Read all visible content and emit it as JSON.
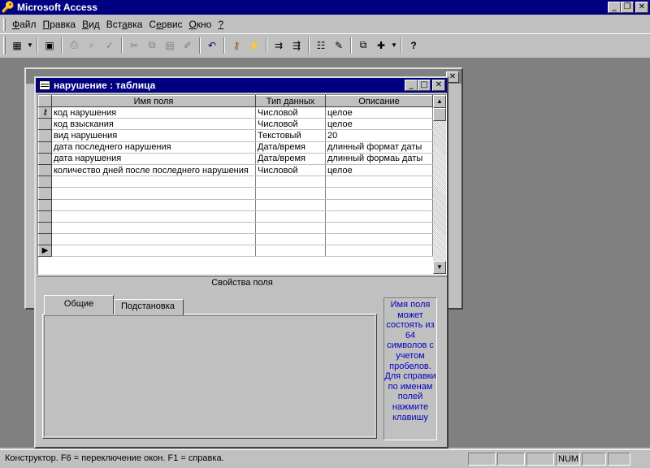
{
  "app": {
    "title": "Microsoft Access"
  },
  "menu": {
    "items": [
      {
        "u": "Ф",
        "rest": "айл"
      },
      {
        "u": "П",
        "rest": "равка"
      },
      {
        "u": "В",
        "rest": "ид"
      },
      {
        "pre": "Вст",
        "u": "а",
        "rest": "вка"
      },
      {
        "pre": "С",
        "u": "е",
        "rest": "рвис"
      },
      {
        "u": "О",
        "rest": "кно"
      },
      {
        "u": "?",
        "rest": ""
      }
    ]
  },
  "toolbar": {
    "buttons": [
      {
        "name": "view-icon",
        "glyph": "▦"
      },
      {
        "name": "save-icon",
        "glyph": "💾"
      },
      {
        "name": "print-icon",
        "glyph": "🖶"
      },
      {
        "name": "preview-icon",
        "glyph": "🔍"
      },
      {
        "name": "spelling-icon",
        "glyph": "✓"
      },
      {
        "name": "cut-icon",
        "glyph": "✂"
      },
      {
        "name": "copy-icon",
        "glyph": "⧉"
      },
      {
        "name": "paste-icon",
        "glyph": "📋"
      },
      {
        "name": "format-painter-icon",
        "glyph": "🖌"
      },
      {
        "name": "undo-icon",
        "glyph": "↶"
      },
      {
        "name": "primary-key-icon",
        "glyph": "🔑"
      },
      {
        "name": "indexes-icon",
        "glyph": "⚡"
      },
      {
        "name": "insert-rows-icon",
        "glyph": "⇉"
      },
      {
        "name": "delete-rows-icon",
        "glyph": "⇶"
      },
      {
        "name": "properties-icon",
        "glyph": "🗒"
      },
      {
        "name": "build-icon",
        "glyph": "✎"
      },
      {
        "name": "database-window-icon",
        "glyph": "🗔"
      },
      {
        "name": "new-object-icon",
        "glyph": "✚"
      },
      {
        "name": "help-icon",
        "glyph": "?"
      }
    ]
  },
  "window": {
    "title": "нарушение : таблица"
  },
  "grid": {
    "headers": [
      "Имя поля",
      "Тип данных",
      "Описание"
    ],
    "rows": [
      {
        "key": true,
        "field": "код нарушения",
        "type": "Числовой",
        "desc": "целое"
      },
      {
        "key": false,
        "field": "код взыскания",
        "type": "Числовой",
        "desc": "целое"
      },
      {
        "key": false,
        "field": "вид нарушения",
        "type": "Текстовый",
        "desc": "20"
      },
      {
        "key": false,
        "field": "дата последнего нарушения",
        "type": "Дата/время",
        "desc": "длинный формат даты"
      },
      {
        "key": false,
        "field": "дата нарушения",
        "type": "Дата/время",
        "desc": "длинный формаь даты"
      },
      {
        "key": false,
        "field": "количество дней после последнего нарушения",
        "type": "Числовой",
        "desc": "целое"
      }
    ],
    "empty_rows": 7,
    "current_row_marker": "▶"
  },
  "properties": {
    "label": "Свойства поля",
    "tabs": [
      "Общие",
      "Подстановка"
    ],
    "hint": "Имя поля может состоять из 64 символов с учетом пробелов. Для справки по именам полей нажмите клавишу"
  },
  "status": {
    "message": "Конструктор.  F6 = переключение окон.  F1 = справка.",
    "num": "NUM"
  }
}
